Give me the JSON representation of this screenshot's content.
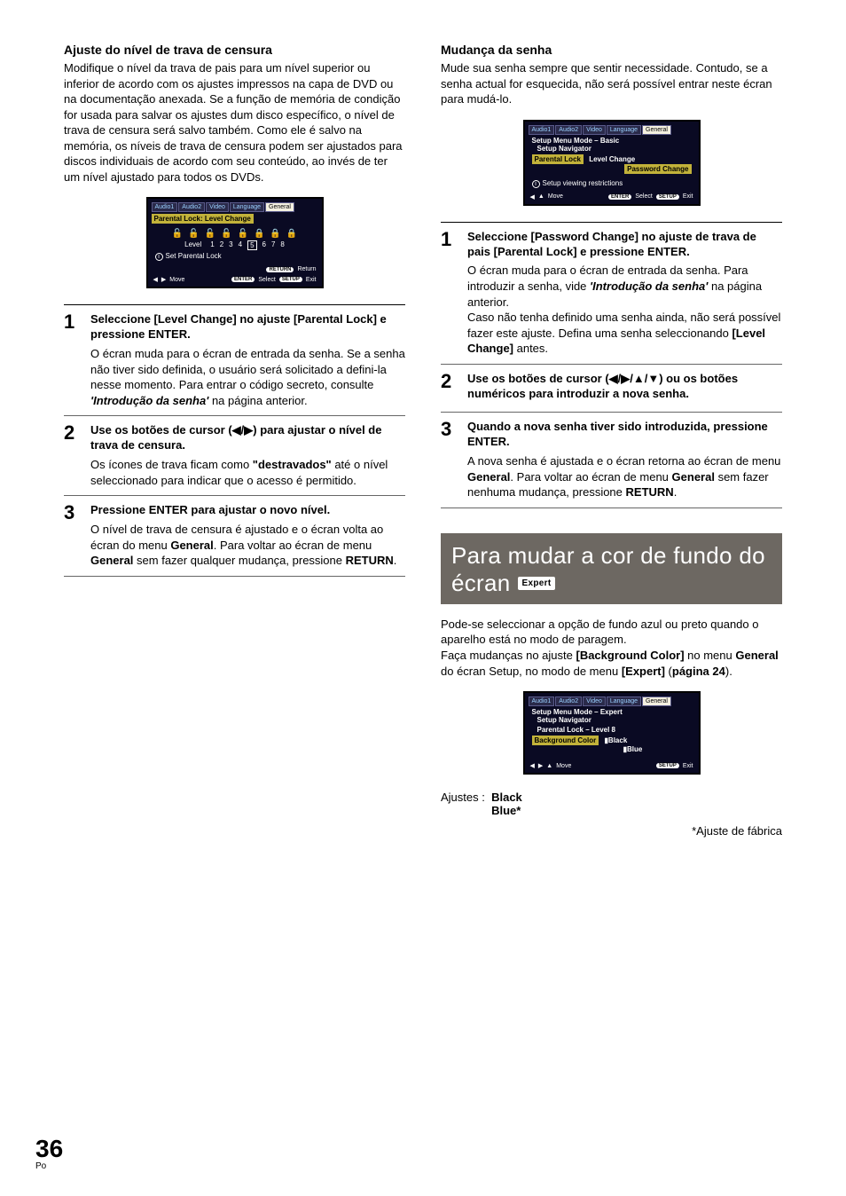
{
  "left": {
    "heading": "Ajuste do nível de trava de censura",
    "intro": "Modifique o nível da trava de pais para um nível superior ou inferior de acordo com os ajustes impressos na capa de DVD ou na documentação anexada. Se a função de memória de condição for usada para salvar os ajustes dum disco específico, o nível de trava de censura será salvo também. Como ele é salvo na memória, os níveis de trava de censura podem ser ajustados para discos individuais de acordo com seu conteúdo, ao invés de ter um nível ajustado para todos os DVDs.",
    "ui": {
      "tabs": [
        "Audio1",
        "Audio2",
        "Video",
        "Language",
        "General"
      ],
      "bar": "Parental Lock: Level Change",
      "level_label": "Level",
      "levels": [
        "1",
        "2",
        "3",
        "4",
        "5",
        "6",
        "7",
        "8"
      ],
      "info": "Set Parental Lock",
      "return_pill": "RETURN",
      "return_txt": "Return",
      "move": "Move",
      "enter_pill": "ENTER",
      "select": "Select",
      "setup_pill": "SETUP",
      "exit": "Exit"
    },
    "steps": {
      "s1": {
        "title": "Seleccione [Level Change] no ajuste [Parental Lock] e pressione ENTER.",
        "body": "O écran muda para o écran de entrada da senha. Se a senha não tiver sido definida, o usuário será solicitado a defini-la nesse momento. Para entrar o código secreto, consulte ",
        "ital": "'Introdução da senha'",
        "body_after": " na página anterior."
      },
      "s2": {
        "title": "Use os botões de cursor (◀/▶) para ajustar o nível de trava de censura.",
        "body_before": "Os ícones de trava ficam como ",
        "bold": "\"destravados\"",
        "body_after": " até o nível seleccionado para indicar que o acesso é permitido."
      },
      "s3": {
        "title": "Pressione ENTER para ajustar o novo nível.",
        "body1": "O nível de trava de censura é ajustado e o écran volta ao écran do menu ",
        "gen1": "General",
        "body2": ". Para voltar ao écran de menu ",
        "gen2": "General",
        "body3": " sem fazer qualquer mudança, pressione ",
        "ret": "RETURN",
        "body4": "."
      }
    }
  },
  "right": {
    "heading": "Mudança da senha",
    "intro": "Mude sua senha sempre que sentir necessidade. Contudo, se a senha actual for esquecida, não será possível entrar neste écran para mudá-lo.",
    "ui": {
      "tabs": [
        "Audio1",
        "Audio2",
        "Video",
        "Language",
        "General"
      ],
      "mode": "Setup Menu Mode – Basic",
      "nav": "Setup Navigator",
      "pl": "Parental Lock",
      "lc": "Level Change",
      "pc": "Password Change",
      "info": "Setup viewing restrictions",
      "move": "Move",
      "enter_pill": "ENTER",
      "select": "Select",
      "setup_pill": "SETUP",
      "exit": "Exit"
    },
    "steps": {
      "s1": {
        "title": "Seleccione [Password Change] no ajuste de trava de pais [Parental Lock] e pressione ENTER.",
        "body1": "O écran muda para o écran de entrada da senha. Para introduzir a senha, vide ",
        "ital": "'Introdução da senha'",
        "body1b": " na página anterior.",
        "body2": "Caso não tenha definido uma senha ainda, não será possível fazer este ajuste. Defina uma senha seleccionando ",
        "bold": "[Level Change]",
        "body2b": " antes."
      },
      "s2": {
        "title": "Use os botões de cursor (◀/▶/▲/▼) ou os botões numéricos para introduzir a nova senha."
      },
      "s3": {
        "title": "Quando a nova senha tiver sido introduzida, pressione ENTER.",
        "body1": "A nova senha é ajustada e o écran retorna ao écran de menu ",
        "gen1": "General",
        "body2": ". Para voltar ao écran de menu ",
        "gen2": "General",
        "body3": " sem fazer nenhuma mudança, pressione ",
        "ret": "RETURN",
        "body4": "."
      }
    },
    "banner": {
      "line1": "Para mudar a cor de fundo do",
      "line2": "écran",
      "badge": "Expert"
    },
    "after_banner": {
      "p1a": "Pode-se seleccionar a opção de fundo azul ou preto quando o aparelho está no modo de paragem.",
      "p1b": "Faça mudanças no ajuste ",
      "b1": "[Background Color]",
      "p1c": " no menu ",
      "b2": "General",
      "p1d": " do écran Setup, no modo de menu ",
      "b3": "[Expert]",
      "p1e": " (",
      "b4": "página 24",
      "p1f": ")."
    },
    "ui2": {
      "tabs": [
        "Audio1",
        "Audio2",
        "Video",
        "Language",
        "General"
      ],
      "mode": "Setup Menu Mode – Expert",
      "nav": "Setup Navigator",
      "pl": "Parental Lock – Level 8",
      "bg": "Background Color",
      "black": "Black",
      "blue": "Blue",
      "move": "Move",
      "setup_pill": "SETUP",
      "exit": "Exit"
    },
    "ajustes_label": "Ajustes  :",
    "ajustes_black": "Black",
    "ajustes_blue": "Blue*",
    "fabrica": "*Ajuste de fábrica"
  },
  "footer": {
    "page": "36",
    "lang": "Po"
  }
}
